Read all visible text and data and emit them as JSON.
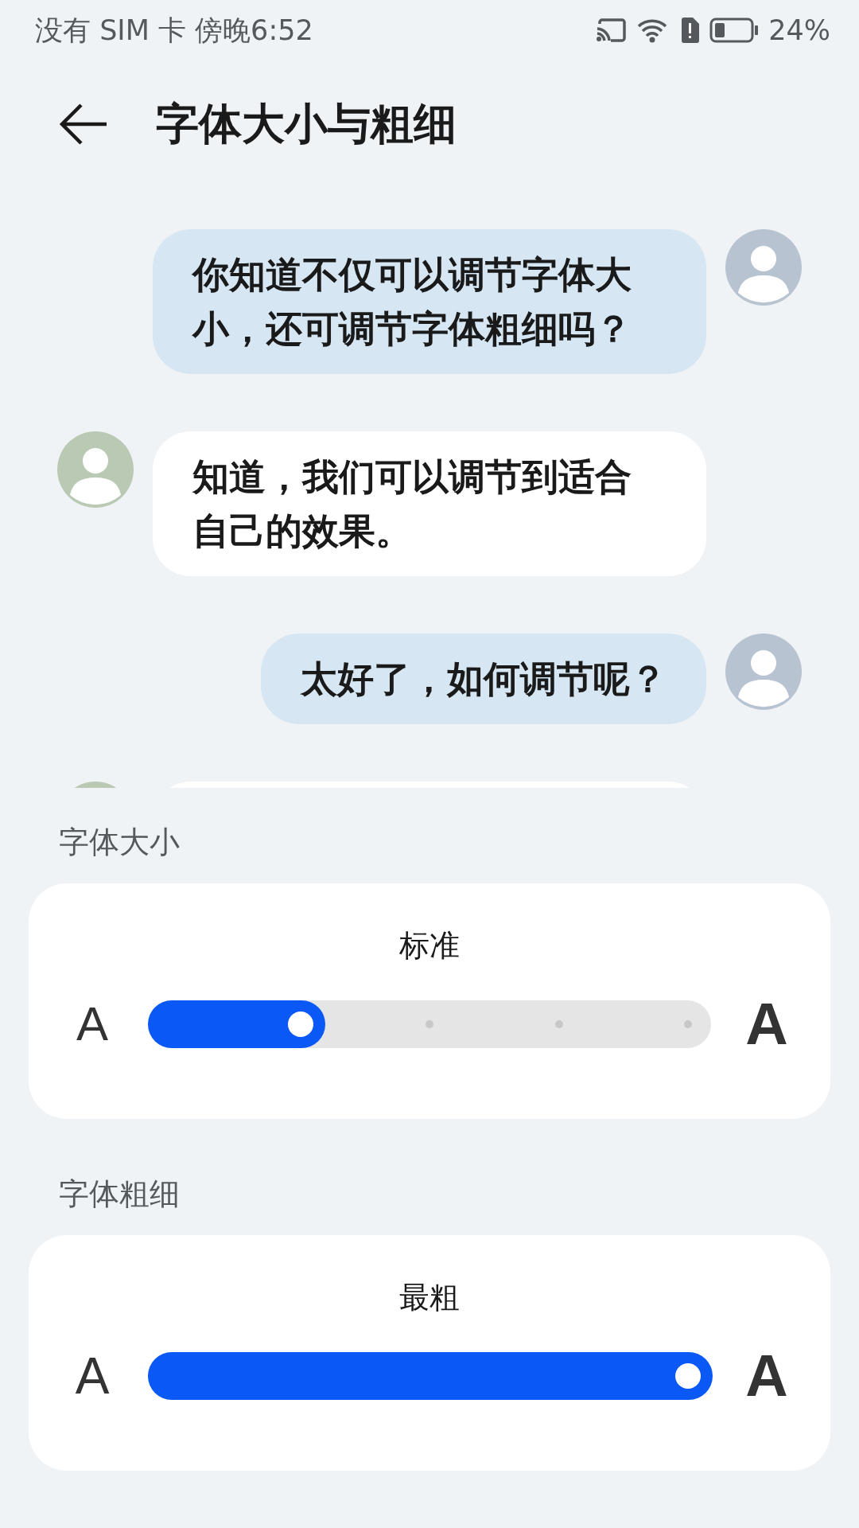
{
  "status_bar": {
    "carrier_time": "没有 SIM 卡 傍晚6:52",
    "battery": "24%"
  },
  "header": {
    "title": "字体大小与粗细"
  },
  "messages": [
    {
      "kind": "sent",
      "text": "你知道不仅可以调节字体大小，还可调节字体粗细吗？"
    },
    {
      "kind": "received",
      "text": "知道，我们可以调节到适合自己的效果。"
    },
    {
      "kind": "sent",
      "text": "太好了，如何调节呢？"
    },
    {
      "kind": "received"
    }
  ],
  "sections": [
    {
      "heading": "字体大小",
      "value": "标准",
      "kind": "size",
      "small_label": "A",
      "large_label": "A",
      "level": 0.25
    },
    {
      "heading": "字体粗细",
      "value": "最粗",
      "kind": "weight",
      "small_label": "A",
      "large_label": "A",
      "level": 1
    }
  ]
}
